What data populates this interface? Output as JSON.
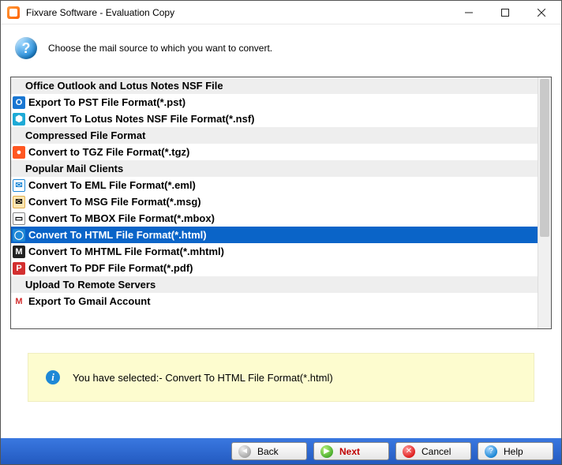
{
  "window": {
    "title": "Fixvare Software - Evaluation Copy"
  },
  "instruction": "Choose the mail source to which you want to convert.",
  "list": {
    "groups": [
      {
        "header": "Office Outlook and Lotus Notes NSF File",
        "items": [
          {
            "icon": "pst",
            "label": "Export To PST File Format(*.pst)",
            "selected": false
          },
          {
            "icon": "nsf",
            "label": "Convert To Lotus Notes NSF File Format(*.nsf)",
            "selected": false
          }
        ]
      },
      {
        "header": "Compressed File Format",
        "items": [
          {
            "icon": "tgz",
            "label": "Convert to TGZ File Format(*.tgz)",
            "selected": false
          }
        ]
      },
      {
        "header": "Popular Mail Clients",
        "items": [
          {
            "icon": "eml",
            "label": "Convert To EML File Format(*.eml)",
            "selected": false
          },
          {
            "icon": "msg",
            "label": "Convert To MSG File Format(*.msg)",
            "selected": false
          },
          {
            "icon": "mbox",
            "label": "Convert To MBOX File Format(*.mbox)",
            "selected": false
          },
          {
            "icon": "html",
            "label": "Convert To HTML File Format(*.html)",
            "selected": true
          },
          {
            "icon": "mhtml",
            "label": "Convert To MHTML File Format(*.mhtml)",
            "selected": false
          },
          {
            "icon": "pdf",
            "label": "Convert To PDF File Format(*.pdf)",
            "selected": false
          }
        ]
      },
      {
        "header": "Upload To Remote Servers",
        "items": [
          {
            "icon": "gmail",
            "label": "Export To Gmail Account",
            "selected": false
          }
        ]
      }
    ]
  },
  "info": {
    "text": "You have selected:- Convert To HTML File Format(*.html)"
  },
  "buttons": {
    "back": "Back",
    "next": "Next",
    "cancel": "Cancel",
    "help": "Help"
  }
}
